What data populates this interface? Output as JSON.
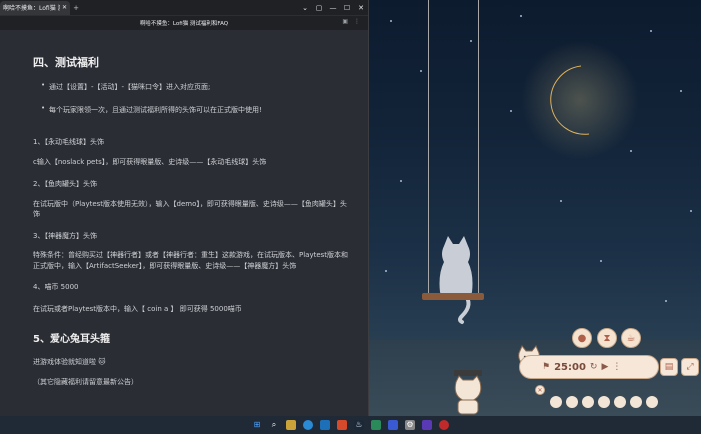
{
  "browser": {
    "tab_title": "啊哈不摸鱼：Lofi猫 测试...",
    "page_title": "啊哈不摸鱼：Lofi猫 测试福利和FAQ",
    "new_tab": "+",
    "close_tab": "✕"
  },
  "article": {
    "heading1": "四、测试福利",
    "bullets": [
      "通过【设置】-【活动】-【猫咪口令】进入对应页面;",
      "每个玩家限领一次，且通过测试福利所得的头饰可以在正式版中使用!"
    ],
    "items": [
      {
        "title": "1、【永动毛线球】头饰",
        "body": "c输入【noslack pets】，即可获得眼量版、史诗级——【永动毛线球】头饰"
      },
      {
        "title": "2、【鱼肉罐头】头饰",
        "body": "在试玩版中（Playtest版本使用无效），输入【demo】，即可获得眼量版、史诗级——【鱼肉罐头】头饰"
      },
      {
        "title": "3、【神器魔方】头饰",
        "body": "特殊条件：曾经购买过【神器行者】或者【神器行者：重生】这款游戏，在试玩版本、Playtest版本和正式版中，输入【ArtifactSeeker】，即可获得眼量版、史诗级——【神器魔方】头饰"
      },
      {
        "title": "4、喵币 5000",
        "body": "在试玩或者Playtest版本中，输入【 coin a 】 即可获得 5000喵币"
      }
    ],
    "heading2": "5、爱心兔耳头箍",
    "line1": "进游戏体验就知道啦 🐱",
    "line2": "（其它隐藏福利请留意最新公告）"
  },
  "widget": {
    "timer": "25:00",
    "icons": [
      "tomato-icon",
      "hourglass-icon",
      "coffee-icon"
    ]
  },
  "colors": {
    "page_bg": "#2a2d34",
    "widget_bg": "#f6e7d8",
    "accent": "#b0604a"
  }
}
